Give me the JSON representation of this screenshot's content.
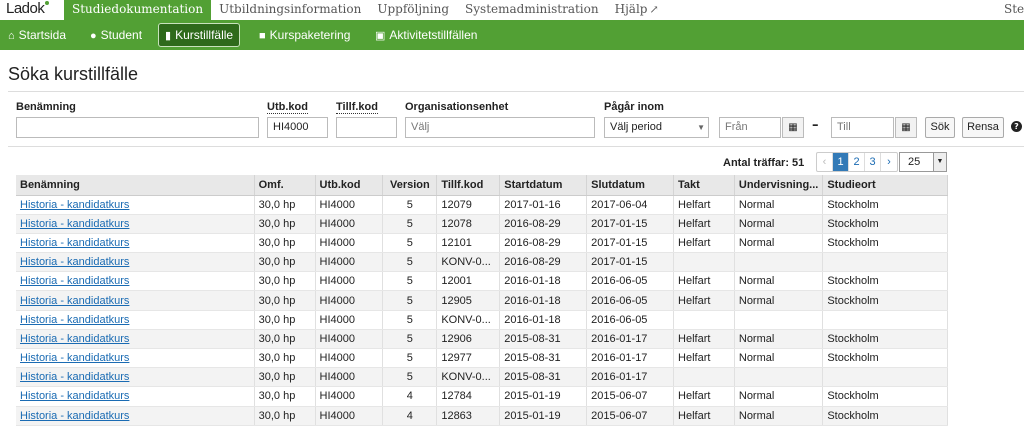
{
  "logo": "Ladok",
  "top_nav": [
    {
      "label": "Studiedokumentation"
    },
    {
      "label": "Utbildningsinformation"
    },
    {
      "label": "Uppföljning"
    },
    {
      "label": "Systemadministration"
    },
    {
      "label": "Hjälp"
    }
  ],
  "top_right_text": "Ste",
  "sub_nav": [
    {
      "label": "Startsida",
      "icon": "home-icon"
    },
    {
      "label": "Student",
      "icon": "user-icon"
    },
    {
      "label": "Kurstillfälle",
      "icon": "book-icon"
    },
    {
      "label": "Kurspaketering",
      "icon": "folder-icon"
    },
    {
      "label": "Aktivitetstillfällen",
      "icon": "calendar-icon"
    }
  ],
  "page_title": "Söka kurstillfälle",
  "filters": {
    "benamning_label": "Benämning",
    "benamning_value": "",
    "utbkod_label": "Utb.kod",
    "utbkod_value": "HI4000",
    "tillfkod_label": "Tillf.kod",
    "tillfkod_value": "",
    "org_label": "Organisationsenhet",
    "org_placeholder": "Välj",
    "pagar_label": "Pågår inom",
    "pagar_placeholder": "Välj period",
    "fran_placeholder": "Från",
    "till_placeholder": "Till",
    "search_button": "Sök",
    "clear_button": "Rensa"
  },
  "results": {
    "hits_label": "Antal träffar: 51",
    "pages": [
      "‹",
      "1",
      "2",
      "3",
      "›"
    ],
    "page_size": "25"
  },
  "table": {
    "headers": [
      "Benämning",
      "Omf.",
      "Utb.kod",
      "Version",
      "Tillf.kod",
      "Startdatum",
      "Slutdatum",
      "Takt",
      "Undervisning...",
      "Studieort"
    ],
    "rows": [
      [
        "Historia - kandidatkurs",
        "30,0 hp",
        "HI4000",
        "5",
        "12079",
        "2017-01-16",
        "2017-06-04",
        "Helfart",
        "Normal",
        "Stockholm"
      ],
      [
        "Historia - kandidatkurs",
        "30,0 hp",
        "HI4000",
        "5",
        "12078",
        "2016-08-29",
        "2017-01-15",
        "Helfart",
        "Normal",
        "Stockholm"
      ],
      [
        "Historia - kandidatkurs",
        "30,0 hp",
        "HI4000",
        "5",
        "12101",
        "2016-08-29",
        "2017-01-15",
        "Helfart",
        "Normal",
        "Stockholm"
      ],
      [
        "Historia - kandidatkurs",
        "30,0 hp",
        "HI4000",
        "5",
        "KONV-0...",
        "2016-08-29",
        "2017-01-15",
        "",
        "",
        ""
      ],
      [
        "Historia - kandidatkurs",
        "30,0 hp",
        "HI4000",
        "5",
        "12001",
        "2016-01-18",
        "2016-06-05",
        "Helfart",
        "Normal",
        "Stockholm"
      ],
      [
        "Historia - kandidatkurs",
        "30,0 hp",
        "HI4000",
        "5",
        "12905",
        "2016-01-18",
        "2016-06-05",
        "Helfart",
        "Normal",
        "Stockholm"
      ],
      [
        "Historia - kandidatkurs",
        "30,0 hp",
        "HI4000",
        "5",
        "KONV-0...",
        "2016-01-18",
        "2016-06-05",
        "",
        "",
        ""
      ],
      [
        "Historia - kandidatkurs",
        "30,0 hp",
        "HI4000",
        "5",
        "12906",
        "2015-08-31",
        "2016-01-17",
        "Helfart",
        "Normal",
        "Stockholm"
      ],
      [
        "Historia - kandidatkurs",
        "30,0 hp",
        "HI4000",
        "5",
        "12977",
        "2015-08-31",
        "2016-01-17",
        "Helfart",
        "Normal",
        "Stockholm"
      ],
      [
        "Historia - kandidatkurs",
        "30,0 hp",
        "HI4000",
        "5",
        "KONV-0...",
        "2015-08-31",
        "2016-01-17",
        "",
        "",
        ""
      ],
      [
        "Historia - kandidatkurs",
        "30,0 hp",
        "HI4000",
        "4",
        "12784",
        "2015-01-19",
        "2015-06-07",
        "Helfart",
        "Normal",
        "Stockholm"
      ],
      [
        "Historia - kandidatkurs",
        "30,0 hp",
        "HI4000",
        "4",
        "12863",
        "2015-01-19",
        "2015-06-07",
        "Helfart",
        "Normal",
        "Stockholm"
      ]
    ]
  },
  "colors": {
    "brand_green": "#52a034",
    "active_subnav": "#2e6a1b",
    "link": "#1a6bb3"
  }
}
